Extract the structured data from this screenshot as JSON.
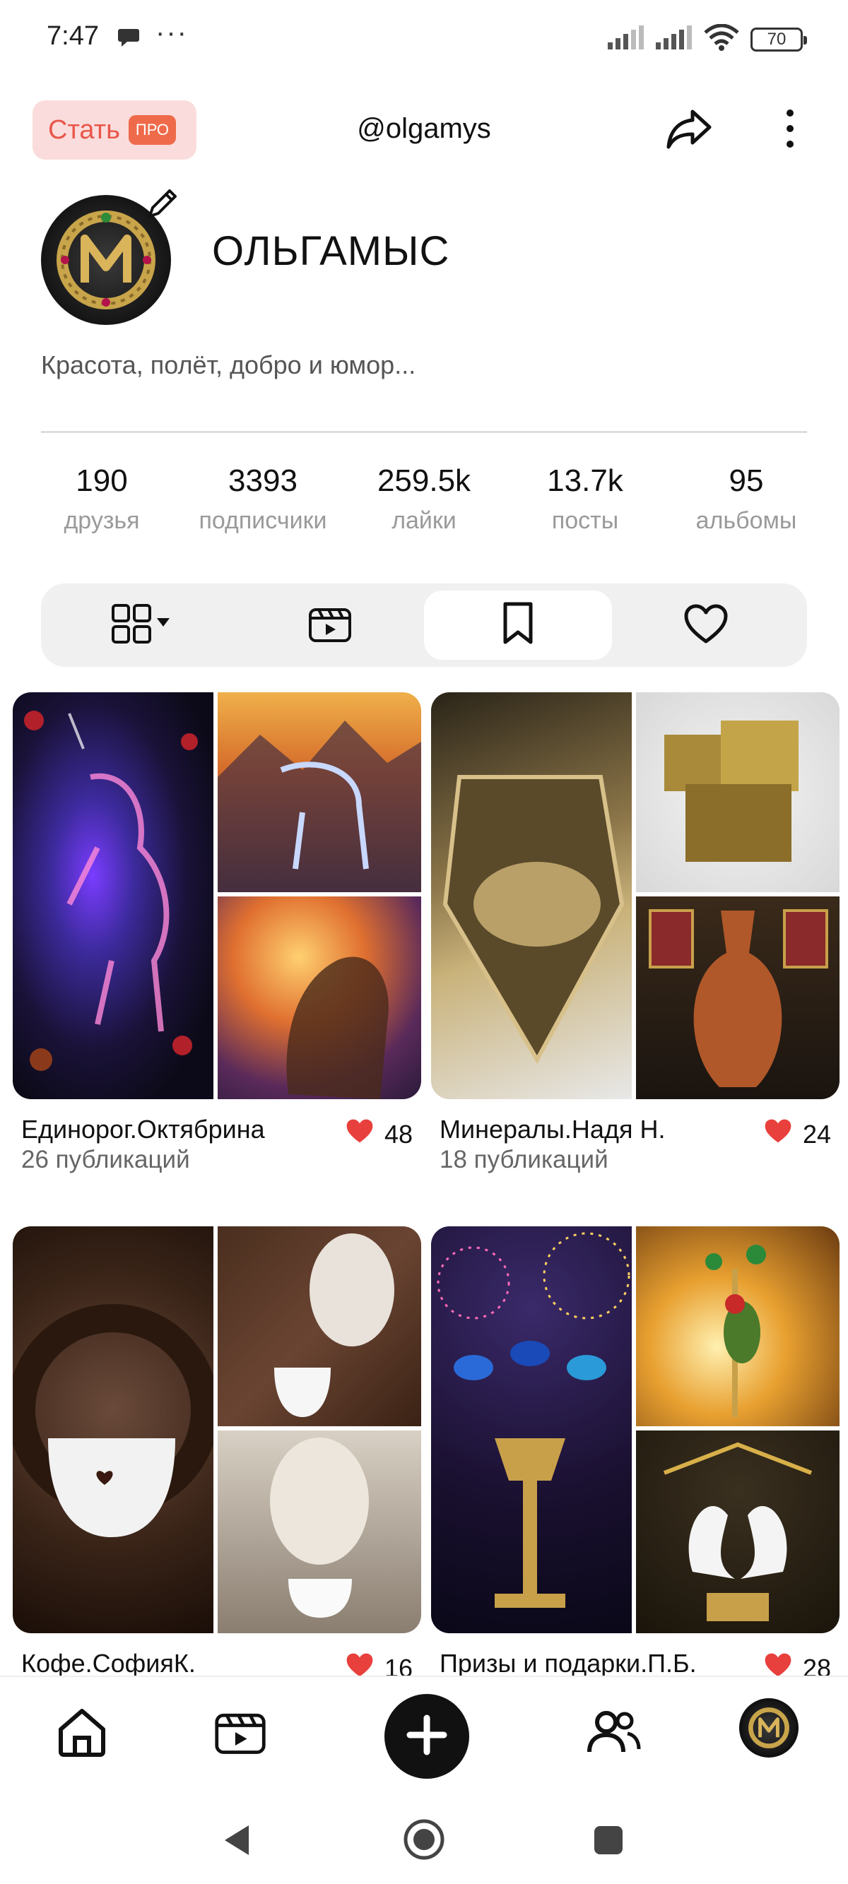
{
  "status_bar": {
    "time": "7:47",
    "dots": "···",
    "battery": "70"
  },
  "header": {
    "pro_label": "Стать",
    "pro_badge": "ПРО",
    "username": "@olgamys"
  },
  "profile": {
    "display_name": "ОЛЬГАМЫС",
    "bio": "Красота, полёт, добро и юмор..."
  },
  "stats": [
    {
      "value": "190",
      "label": "друзья"
    },
    {
      "value": "3393",
      "label": "подписчики"
    },
    {
      "value": "259.5k",
      "label": "лайки"
    },
    {
      "value": "13.7k",
      "label": "посты"
    },
    {
      "value": "95",
      "label": "альбомы"
    }
  ],
  "albums": [
    {
      "title": "Единорог.Октябрина",
      "count": "26 публикаций",
      "likes": "48"
    },
    {
      "title": "Минералы.Надя Н.",
      "count": "18 публикаций",
      "likes": "24"
    },
    {
      "title": "Кофе.СофияК.",
      "count": "",
      "likes": "16"
    },
    {
      "title": "Призы и подарки.П.Б.",
      "count": "",
      "likes": "28"
    }
  ],
  "colors": {
    "accent": "#e8574a",
    "like": "#e8403c",
    "pro_bg": "#fbdcdc"
  }
}
